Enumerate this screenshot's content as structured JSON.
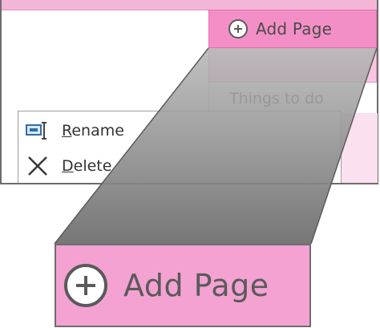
{
  "toolbar": {
    "add_page_label": "Add Page",
    "add_icon": "plus-circle-icon"
  },
  "pages": {
    "items": [
      {
        "label": "Things to do"
      }
    ]
  },
  "context_menu": {
    "items": [
      {
        "label": "Rename",
        "icon": "rename-icon"
      },
      {
        "label": "Delete",
        "icon": "delete-x-icon"
      }
    ]
  },
  "zoom_callout": {
    "label": "Add Page",
    "icon": "plus-circle-icon"
  },
  "colors": {
    "accent_pink": "#f38fc6",
    "light_pink": "#f8c6e2",
    "frame_gray": "#6d6d6d",
    "funnel_gray": "#8a8a8a"
  }
}
